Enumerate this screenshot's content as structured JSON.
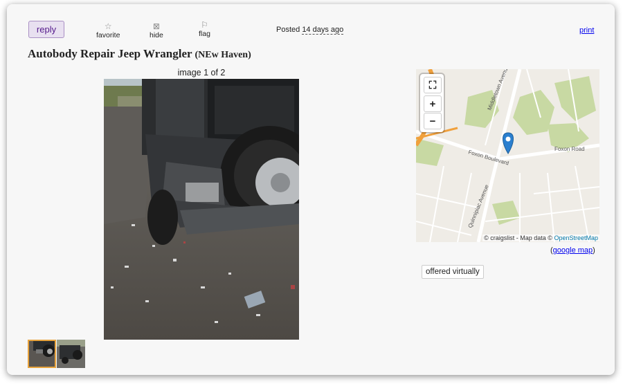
{
  "actions": {
    "reply_label": "reply",
    "favorite_label": "favorite",
    "hide_label": "hide",
    "flag_label": "flag",
    "posted_prefix": "Posted",
    "posted_ago": "14 days ago",
    "print_label": "print"
  },
  "posting": {
    "title": "Autobody Repair Jeep Wrangler",
    "location": "(NEw Haven)"
  },
  "gallery": {
    "counter": "image 1 of 2",
    "selected_index": 1,
    "total": 2
  },
  "map": {
    "zoom_in": "+",
    "zoom_out": "−",
    "attribution_prefix": "© craigslist - Map data ©",
    "attribution_link": "OpenStreetMap",
    "street_labels": [
      "Foxon Road",
      "Foxon Boulevard",
      "Quinnipiac Avenue",
      "Middletown Avenue"
    ],
    "google_map_label": "google map"
  },
  "attributes": {
    "tag": "offered virtually"
  },
  "colors": {
    "reply_bg": "#e8e0f0",
    "link": "#0000ee",
    "map_park": "#c8d9a3",
    "map_highway": "#f0a03c",
    "map_marker": "#2a7fcf"
  }
}
